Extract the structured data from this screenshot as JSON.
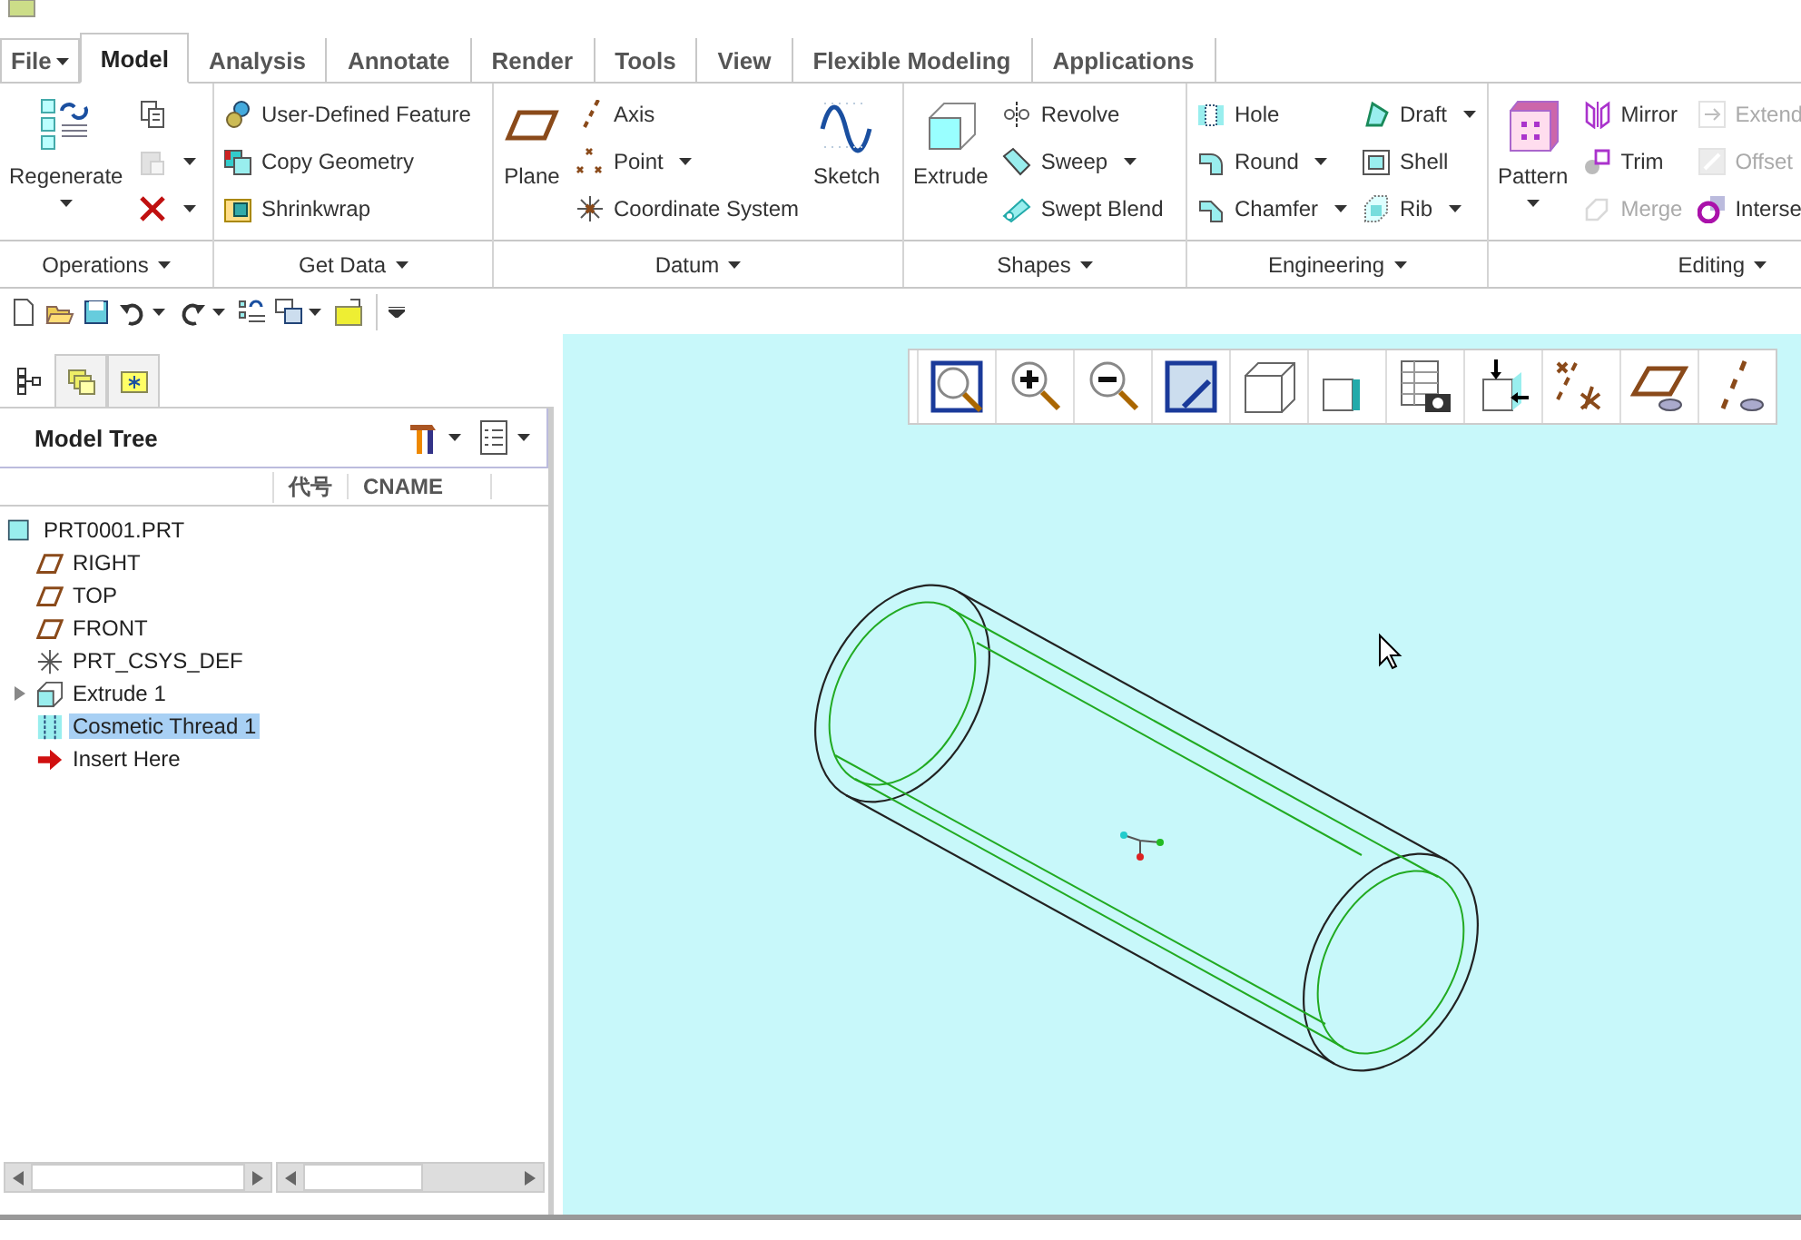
{
  "tabs": [
    {
      "label": "File",
      "selected": false,
      "dropdown": true
    },
    {
      "label": "Model",
      "selected": true,
      "dropdown": false
    },
    {
      "label": "Analysis",
      "selected": false,
      "dropdown": false
    },
    {
      "label": "Annotate",
      "selected": false,
      "dropdown": false
    },
    {
      "label": "Render",
      "selected": false,
      "dropdown": false
    },
    {
      "label": "Tools",
      "selected": false,
      "dropdown": false
    },
    {
      "label": "View",
      "selected": false,
      "dropdown": false
    },
    {
      "label": "Flexible Modeling",
      "selected": false,
      "dropdown": false
    },
    {
      "label": "Applications",
      "selected": false,
      "dropdown": false
    }
  ],
  "ribbon": {
    "groups": [
      {
        "label": "Operations",
        "columns": [
          {
            "kind": "large",
            "label": "Regenerate",
            "caret": true
          },
          {
            "kind": "stack",
            "items": [
              {
                "caret": false,
                "disabled": false
              },
              {
                "caret": true,
                "disabled": true
              },
              {
                "caret": true,
                "disabled": false
              }
            ]
          }
        ]
      },
      {
        "label": "Get Data",
        "columns": [
          {
            "kind": "stack",
            "items": [
              {
                "label": "User-Defined Feature",
                "caret": false,
                "disabled": false
              },
              {
                "label": "Copy Geometry",
                "caret": false,
                "disabled": false
              },
              {
                "label": "Shrinkwrap",
                "caret": false,
                "disabled": false
              }
            ]
          }
        ]
      },
      {
        "label": "Datum",
        "columns": [
          {
            "kind": "large",
            "label": "Plane",
            "caret": false
          },
          {
            "kind": "stack",
            "items": [
              {
                "label": "Axis",
                "caret": false,
                "disabled": false
              },
              {
                "label": "Point",
                "caret": true,
                "disabled": false
              },
              {
                "label": "Coordinate System",
                "caret": false,
                "disabled": false
              }
            ]
          },
          {
            "kind": "large",
            "label": "Sketch",
            "caret": false
          }
        ]
      },
      {
        "label": "Shapes",
        "columns": [
          {
            "kind": "large",
            "label": "Extrude",
            "caret": false
          },
          {
            "kind": "stack",
            "items": [
              {
                "label": "Revolve",
                "caret": false,
                "disabled": false
              },
              {
                "label": "Sweep",
                "caret": true,
                "disabled": false
              },
              {
                "label": "Swept Blend",
                "caret": false,
                "disabled": false
              }
            ]
          }
        ]
      },
      {
        "label": "Engineering",
        "columns": [
          {
            "kind": "stack",
            "items": [
              {
                "label": "Hole",
                "caret": false,
                "disabled": false
              },
              {
                "label": "Round",
                "caret": true,
                "disabled": false
              },
              {
                "label": "Chamfer",
                "caret": true,
                "disabled": false
              }
            ]
          },
          {
            "kind": "stack",
            "items": [
              {
                "label": "Draft",
                "caret": true,
                "disabled": false
              },
              {
                "label": "Shell",
                "caret": false,
                "disabled": false
              },
              {
                "label": "Rib",
                "caret": true,
                "disabled": false
              }
            ]
          }
        ]
      },
      {
        "label": "Editing",
        "columns": [
          {
            "kind": "large",
            "label": "Pattern",
            "caret": true
          },
          {
            "kind": "stack",
            "items": [
              {
                "label": "Mirror",
                "caret": false,
                "disabled": false
              },
              {
                "label": "Trim",
                "caret": false,
                "disabled": false
              },
              {
                "label": "Merge",
                "caret": false,
                "disabled": true
              }
            ]
          },
          {
            "kind": "stack",
            "items": [
              {
                "label": "Extend",
                "caret": false,
                "disabled": true
              },
              {
                "label": "Offset",
                "caret": false,
                "disabled": true
              },
              {
                "label": "Interse",
                "caret": false,
                "disabled": false
              }
            ]
          }
        ]
      }
    ]
  },
  "model_tree": {
    "panel_tabs": [
      {
        "selected": true
      },
      {
        "selected": false
      },
      {
        "selected": false
      }
    ],
    "title": "Model Tree",
    "columns": [
      "代号",
      "CNAME"
    ],
    "root": {
      "label": "PRT0001.PRT",
      "selected": false,
      "children": [
        {
          "label": "RIGHT",
          "selected": false
        },
        {
          "label": "TOP",
          "selected": false
        },
        {
          "label": "FRONT",
          "selected": false
        },
        {
          "label": "PRT_CSYS_DEF",
          "selected": false
        },
        {
          "label": "Extrude 1",
          "selected": false,
          "expanded": false
        },
        {
          "label": "Cosmetic Thread 1",
          "selected": true
        },
        {
          "label": "Insert Here",
          "selected": false
        }
      ]
    }
  }
}
